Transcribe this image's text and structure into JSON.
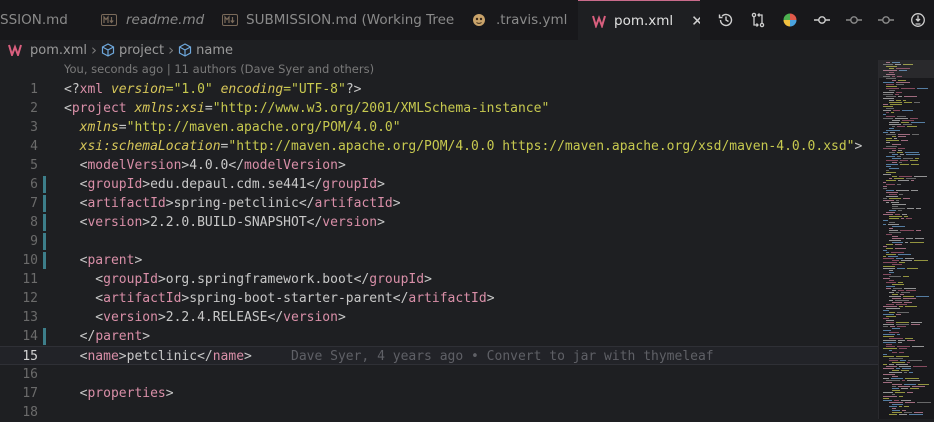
{
  "tabs": [
    {
      "label": "SSION.md",
      "icon": "markdown-icon",
      "italic": false
    },
    {
      "label": "readme.md",
      "icon": "markdown-icon",
      "italic": true
    },
    {
      "label": "SUBMISSION.md (Working Tree)",
      "icon": "markdown-icon",
      "italic": false
    },
    {
      "label": ".travis.yml",
      "icon": "travis-icon",
      "italic": false
    },
    {
      "label": "pom.xml",
      "icon": "maven-icon",
      "italic": false,
      "active": true
    }
  ],
  "close_symbol": "✕",
  "toolbar_icons": [
    "history-icon",
    "compare-changes-icon",
    "git-graph-icon",
    "git-commit-icon",
    "previous-change-icon",
    "next-change-icon",
    "toggle-blame-icon"
  ],
  "breadcrumb": [
    "pom.xml",
    "project",
    "name"
  ],
  "blame_header": "You, seconds ago | 11 authors (Dave Syer and others)",
  "inline_blame": "Dave Syer, 4 years ago • Convert to jar with thymeleaf",
  "current_line": 15,
  "modified_lines": [
    6,
    7,
    8,
    9,
    10,
    14
  ],
  "colors": {
    "tag": "#d98fa8",
    "attr": "#d6c659",
    "string": "#c7c94f",
    "text": "#c8c8c8",
    "gutter_modified": "#3d7e8a",
    "active_tab_border": "#c96b8b",
    "maven_icon": "#d95f7e"
  },
  "lines": [
    {
      "n": "1",
      "tokens": [
        [
          "<?",
          "text"
        ],
        [
          "xml",
          "tag"
        ],
        [
          " ",
          "text"
        ],
        [
          "version",
          "attr"
        ],
        [
          "=\"1.0\" ",
          "string"
        ],
        [
          "encoding",
          "attr"
        ],
        [
          "=\"UTF-8\"",
          "string"
        ],
        [
          "?>",
          "text"
        ]
      ]
    },
    {
      "n": "2",
      "tokens": [
        [
          "<",
          "text"
        ],
        [
          "project",
          "tag"
        ],
        [
          " ",
          "text"
        ],
        [
          "xmlns:xsi",
          "attr"
        ],
        [
          "=",
          "text"
        ],
        [
          "\"http://www.w3.org/2001/XMLSchema-instance\"",
          "string"
        ]
      ]
    },
    {
      "n": "3",
      "tokens": [
        [
          "  ",
          "text"
        ],
        [
          "xmlns",
          "attr"
        ],
        [
          "=",
          "text"
        ],
        [
          "\"http://maven.apache.org/POM/4.0.0\"",
          "string"
        ]
      ]
    },
    {
      "n": "4",
      "tokens": [
        [
          "  ",
          "text"
        ],
        [
          "xsi:schemaLocation",
          "attr"
        ],
        [
          "=",
          "text"
        ],
        [
          "\"http://maven.apache.org/POM/4.0.0 https://maven.apache.org/xsd/maven-4.0.0.xsd\"",
          "string"
        ],
        [
          ">",
          "text"
        ]
      ]
    },
    {
      "n": "5",
      "tokens": [
        [
          "  <",
          "text"
        ],
        [
          "modelVersion",
          "tag"
        ],
        [
          ">4.0.0</",
          "text"
        ],
        [
          "modelVersion",
          "tag"
        ],
        [
          ">",
          "text"
        ]
      ]
    },
    {
      "n": "6",
      "tokens": [
        [
          "  <",
          "text"
        ],
        [
          "groupId",
          "tag"
        ],
        [
          ">edu.depaul.cdm.se441</",
          "text"
        ],
        [
          "groupId",
          "tag"
        ],
        [
          ">",
          "text"
        ]
      ]
    },
    {
      "n": "7",
      "tokens": [
        [
          "  <",
          "text"
        ],
        [
          "artifactId",
          "tag"
        ],
        [
          ">spring-petclinic</",
          "text"
        ],
        [
          "artifactId",
          "tag"
        ],
        [
          ">",
          "text"
        ]
      ]
    },
    {
      "n": "8",
      "tokens": [
        [
          "  <",
          "text"
        ],
        [
          "version",
          "tag"
        ],
        [
          ">2.2.0.BUILD-SNAPSHOT</",
          "text"
        ],
        [
          "version",
          "tag"
        ],
        [
          ">",
          "text"
        ]
      ]
    },
    {
      "n": "9",
      "tokens": []
    },
    {
      "n": "10",
      "tokens": [
        [
          "  <",
          "text"
        ],
        [
          "parent",
          "tag"
        ],
        [
          ">",
          "text"
        ]
      ]
    },
    {
      "n": "11",
      "tokens": [
        [
          "    <",
          "text"
        ],
        [
          "groupId",
          "tag"
        ],
        [
          ">org.springframework.boot</",
          "text"
        ],
        [
          "groupId",
          "tag"
        ],
        [
          ">",
          "text"
        ]
      ]
    },
    {
      "n": "12",
      "tokens": [
        [
          "    <",
          "text"
        ],
        [
          "artifactId",
          "tag"
        ],
        [
          ">spring-boot-starter-parent</",
          "text"
        ],
        [
          "artifactId",
          "tag"
        ],
        [
          ">",
          "text"
        ]
      ]
    },
    {
      "n": "13",
      "tokens": [
        [
          "    <",
          "text"
        ],
        [
          "version",
          "tag"
        ],
        [
          ">2.2.4.RELEASE</",
          "text"
        ],
        [
          "version",
          "tag"
        ],
        [
          ">",
          "text"
        ]
      ]
    },
    {
      "n": "14",
      "tokens": [
        [
          "  </",
          "text"
        ],
        [
          "parent",
          "tag"
        ],
        [
          ">",
          "text"
        ]
      ]
    },
    {
      "n": "15",
      "tokens": [
        [
          "  <",
          "text"
        ],
        [
          "name",
          "tag"
        ],
        [
          ">petclinic</",
          "text"
        ],
        [
          "name",
          "tag"
        ],
        [
          ">",
          "text"
        ]
      ]
    },
    {
      "n": "16",
      "tokens": []
    },
    {
      "n": "17",
      "tokens": [
        [
          "  <",
          "text"
        ],
        [
          "properties",
          "tag"
        ],
        [
          ">",
          "text"
        ]
      ]
    },
    {
      "n": "18",
      "tokens": []
    }
  ]
}
